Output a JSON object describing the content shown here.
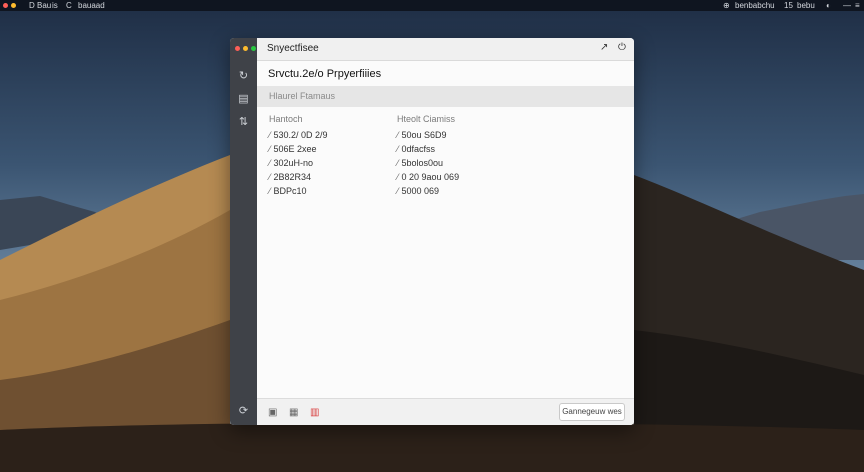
{
  "menubar": {
    "left_items": [
      "D Bau",
      "is",
      "C",
      "bauaad"
    ],
    "right_items": [
      "benbabchu",
      "15",
      "bebu",
      "—"
    ]
  },
  "window": {
    "title": "Snyectfisee",
    "heading": "Srvctu.2e/o Prpyerfiiies",
    "section_label": "Hlaurel Ftamaus",
    "columns": [
      {
        "header": "Hantoch",
        "rows": [
          "530.2/ 0D 2/9",
          "506E 2xee",
          "302uH-no",
          "2B82R34",
          "BDPc10"
        ]
      },
      {
        "header": "Hteolt Ciamiss",
        "rows": [
          "50ou S6D9",
          "0dfacfss",
          "5bolos0ou",
          "0 20 9aou 069",
          "5000 069"
        ]
      }
    ],
    "footer_button": "Gannegeuw wes",
    "footer_icons": [
      "view-icon",
      "folder-icon",
      "delete-icon"
    ]
  },
  "colors": {
    "sidebar": "#3f4248",
    "close": "#ff5f57",
    "minimize": "#febc2e",
    "zoom": "#28c840",
    "delete_icon": "#d83a3a"
  }
}
